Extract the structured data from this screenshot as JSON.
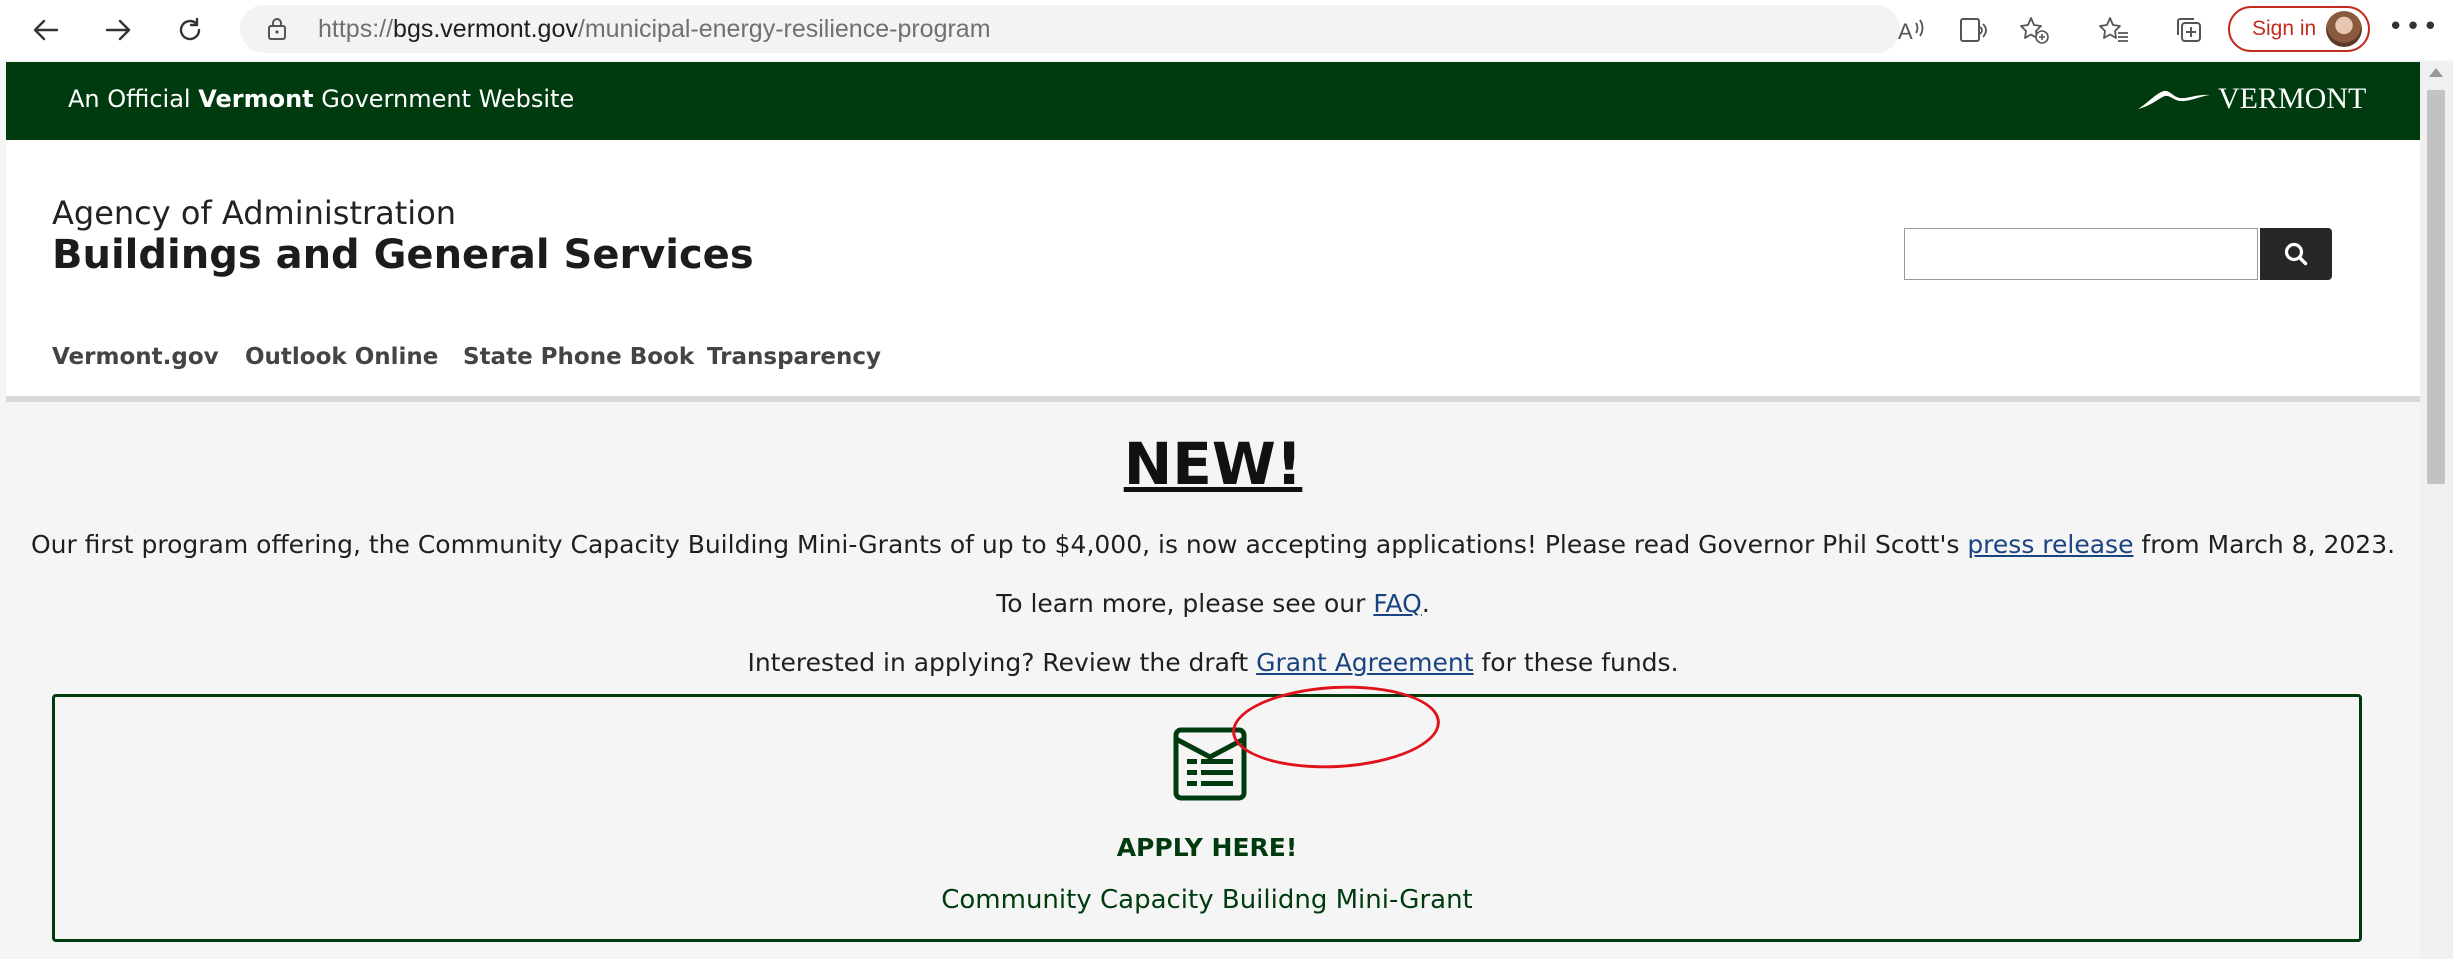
{
  "browser": {
    "url_prefix": "https://",
    "url_host": "bgs.vermont.gov",
    "url_path": "/municipal-energy-resilience-program",
    "signin_label": "Sign in"
  },
  "gov_banner": {
    "pre": "An Official ",
    "bold": "Vermont",
    "post": " Government Website",
    "logo_text": "VERMONT"
  },
  "header": {
    "agency": "Agency of Administration",
    "department": "Buildings and General Services",
    "search_value": ""
  },
  "utility_nav": [
    "Vermont.gov",
    "Outlook Online",
    "State Phone Book",
    "Transparency"
  ],
  "main": {
    "title": "NEW!",
    "p1_before": "Our first program offering, the Community Capacity Building Mini-Grants of up to $4,000, is now accepting applications! Please read Governor Phil Scott's ",
    "p1_link": "press release",
    "p1_after": " from March 8, 2023.",
    "p2_before": "To learn more, please see our ",
    "p2_link": "FAQ",
    "p2_after": ".",
    "p3_before": "Interested in applying? Review the draft ",
    "p3_link": "Grant Agreement",
    "p3_after": " for these funds."
  },
  "apply": {
    "heading": "APPLY HERE!",
    "subtitle": "Community Capacity Builidng Mini-Grant"
  },
  "colors": {
    "brand_green": "#003b0f",
    "link": "#1a4480",
    "annotation": "#e0121b"
  }
}
